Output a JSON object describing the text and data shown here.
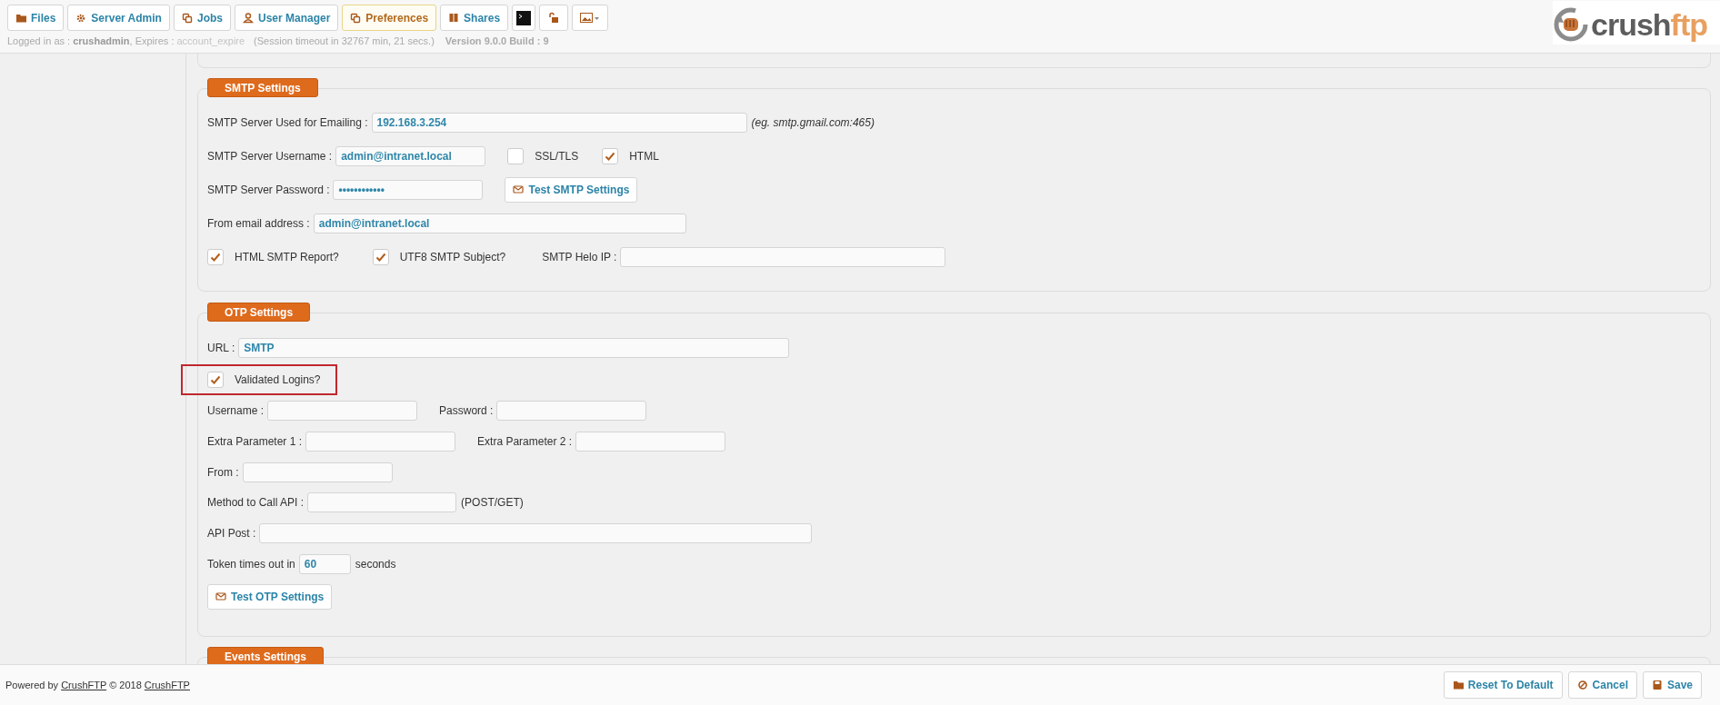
{
  "nav": [
    {
      "label": "Files",
      "kind": "folder",
      "selected": false
    },
    {
      "label": "Server Admin",
      "kind": "gear",
      "selected": false
    },
    {
      "label": "Jobs",
      "kind": "copy",
      "selected": false
    },
    {
      "label": "User Manager",
      "kind": "user",
      "selected": false
    },
    {
      "label": "Preferences",
      "kind": "copy",
      "selected": true
    },
    {
      "label": "Shares",
      "kind": "book",
      "selected": false
    },
    {
      "kind": "terminal",
      "selected": false
    },
    {
      "kind": "lock",
      "selected": false
    },
    {
      "kind": "image",
      "selected": false
    }
  ],
  "logo": {
    "dark": "crush",
    "light": "ftp"
  },
  "session": {
    "prefix": "Logged in as :",
    "user": "crushadmin",
    "expires_label": ", Expires :",
    "expires": "account_expire",
    "timeout": "(Session timeout in 32767 min, 21 secs.)",
    "version": "Version 9.0.0 Build : 9"
  },
  "smtp": {
    "legend": "SMTP Settings",
    "server": {
      "label": "SMTP Server Used for Emailing :",
      "value": "192.168.3.254",
      "hint": "(eg. smtp.gmail.com:465)"
    },
    "username": {
      "label": "SMTP Server Username :",
      "value": "admin@intranet.local"
    },
    "ssl": {
      "label": "SSL/TLS",
      "checked": false
    },
    "html": {
      "label": "HTML",
      "checked": true
    },
    "password": {
      "label": "SMTP Server Password :",
      "value": "••••••••••••"
    },
    "test_button": "Test SMTP Settings",
    "from": {
      "label": "From email address :",
      "value": "admin@intranet.local"
    },
    "html_report": {
      "label": "HTML SMTP Report?",
      "checked": true
    },
    "utf8_subject": {
      "label": "UTF8 SMTP Subject?",
      "checked": true
    },
    "helo": {
      "label": "SMTP Helo IP :"
    }
  },
  "otp": {
    "legend": "OTP Settings",
    "url": {
      "label": "URL :",
      "value": "SMTP"
    },
    "validated": {
      "label": "Validated Logins?",
      "checked": true,
      "highlighted": true
    },
    "username": {
      "label": "Username :"
    },
    "password": {
      "label": "Password :"
    },
    "extra1": {
      "label": "Extra Parameter 1 :"
    },
    "extra2": {
      "label": "Extra Parameter 2 :"
    },
    "from": {
      "label": "From :"
    },
    "method": {
      "label": "Method to Call API :",
      "hint": "(POST/GET)"
    },
    "api_post": {
      "label": "API Post :"
    },
    "token": {
      "label": "Token times out in",
      "value": "60",
      "suffix": "seconds"
    },
    "test_button": "Test OTP Settings"
  },
  "events": {
    "legend": "Events Settings"
  },
  "footer": {
    "powered": "Powered by",
    "link": "CrushFTP",
    "copyright": "© 2018",
    "link2": "CrushFTP",
    "buttons": [
      {
        "label": "Reset To Default",
        "kind": "folder"
      },
      {
        "label": "Cancel",
        "kind": "cancel"
      },
      {
        "label": "Save",
        "kind": "save"
      }
    ]
  }
}
